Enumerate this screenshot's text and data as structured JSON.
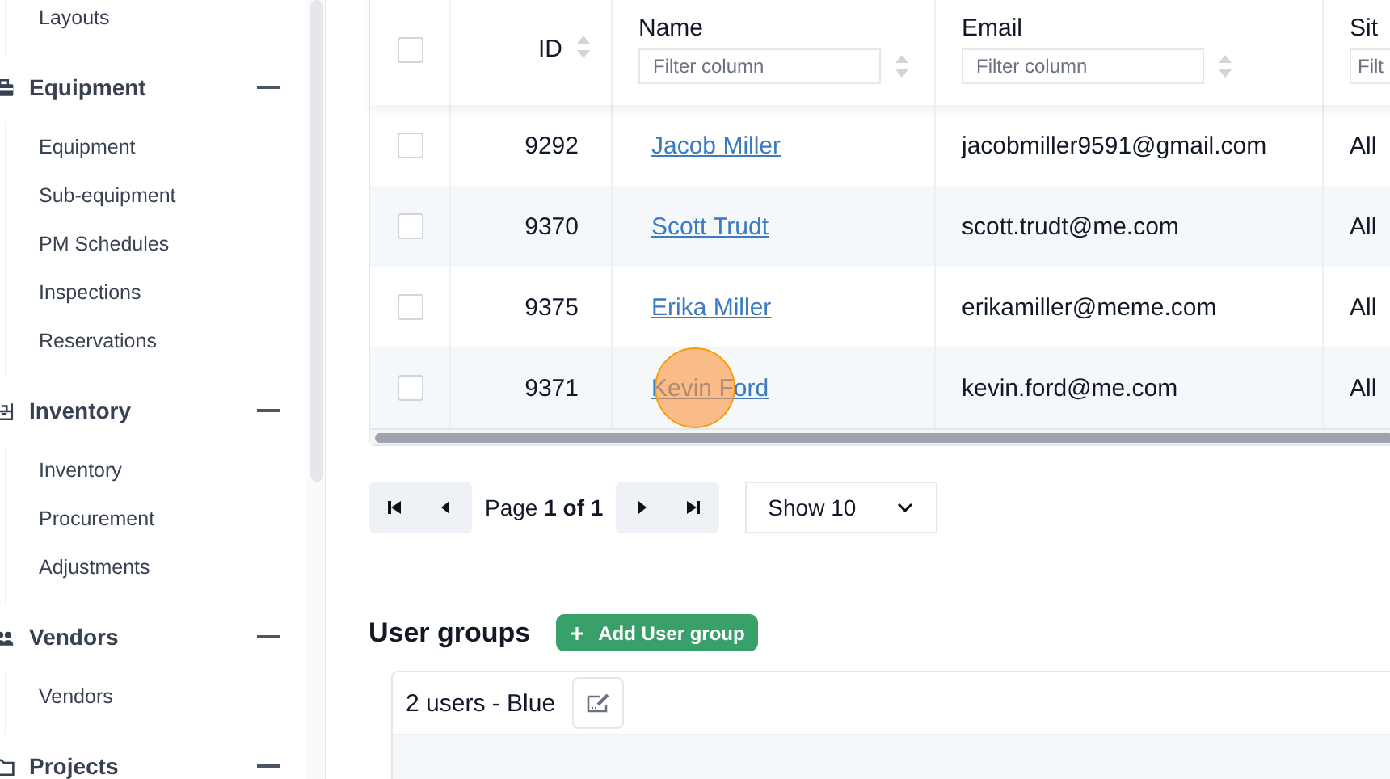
{
  "sidebar": {
    "top_items": [
      {
        "label": "Layouts"
      }
    ],
    "sections": [
      {
        "label": "Equipment",
        "expanded": true,
        "items": [
          {
            "label": "Equipment"
          },
          {
            "label": "Sub-equipment"
          },
          {
            "label": "PM Schedules"
          },
          {
            "label": "Inspections"
          },
          {
            "label": "Reservations"
          }
        ]
      },
      {
        "label": "Inventory",
        "expanded": true,
        "items": [
          {
            "label": "Inventory"
          },
          {
            "label": "Procurement"
          },
          {
            "label": "Adjustments"
          }
        ]
      },
      {
        "label": "Vendors",
        "expanded": true,
        "items": [
          {
            "label": "Vendors"
          }
        ]
      },
      {
        "label": "Projects",
        "expanded": true
      }
    ]
  },
  "table": {
    "select_all_checked": false,
    "columns": [
      {
        "label": "ID"
      },
      {
        "label": "Name",
        "placeholder": "Filter column"
      },
      {
        "label": "Email",
        "placeholder": "Filter column"
      },
      {
        "label": "Sit",
        "placeholder": "Filt"
      }
    ],
    "rows": [
      {
        "checked": false,
        "id": "9292",
        "name": "Jacob Miller",
        "email": "jacobmiller9591@gmail.com",
        "column_4": "All",
        "click_highlight": false
      },
      {
        "checked": false,
        "id": "9370",
        "name": "Scott Trudt",
        "email": "scott.trudt@me.com",
        "column_4": "All",
        "click_highlight": false
      },
      {
        "checked": false,
        "id": "9375",
        "name": "Erika Miller",
        "email": "erikamiller@meme.com",
        "column_4": "All",
        "click_highlight": false
      },
      {
        "checked": false,
        "id": "9371",
        "name": "Kevin Ford",
        "email": "kevin.ford@me.com",
        "column_4": "All",
        "click_highlight": true
      }
    ]
  },
  "pagination": {
    "page_label": "Page",
    "page_value": "1 of 1",
    "show": "Show 10"
  },
  "user_groups": {
    "title": "User groups",
    "add_button": "Add User group",
    "groups": [
      {
        "label": "2 users - Blue"
      }
    ]
  }
}
